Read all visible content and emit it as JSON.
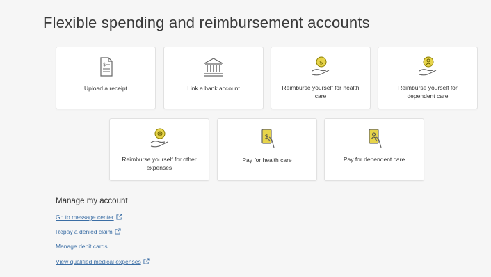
{
  "page": {
    "title": "Flexible spending and reimbursement accounts"
  },
  "actions": [
    {
      "label": "Upload a receipt",
      "icon": "receipt-icon"
    },
    {
      "label": "Link a bank account",
      "icon": "bank-icon"
    },
    {
      "label": "Reimburse yourself for health care",
      "icon": "hand-coin-icon"
    },
    {
      "label": "Reimburse yourself for dependent care",
      "icon": "hand-dependent-icon"
    },
    {
      "label": "Reimburse yourself for other expenses",
      "icon": "hand-plus-icon"
    },
    {
      "label": "Pay for health care",
      "icon": "phone-pay-icon"
    },
    {
      "label": "Pay for dependent care",
      "icon": "phone-dependent-icon"
    }
  ],
  "manage": {
    "title": "Manage my account",
    "links": [
      {
        "label": "Go to message center",
        "external": true
      },
      {
        "label": "Repay a denied claim",
        "external": true
      },
      {
        "label": "Manage debit cards",
        "external": false
      },
      {
        "label": "View qualified medical expenses",
        "external": true
      }
    ]
  },
  "colors": {
    "accent": "#c8b400",
    "link": "#3b6ea5",
    "icon_stroke": "#666666"
  }
}
